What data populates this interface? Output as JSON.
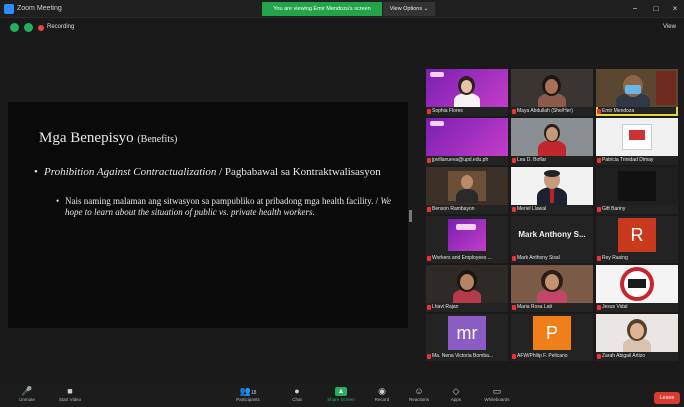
{
  "window": {
    "title": "Zoom Meeting",
    "viewing_banner": "You are viewing Emir Mendoza's screen",
    "view_options": "View Options ⌄",
    "minimize": "−",
    "maximize": "□",
    "close": "×"
  },
  "subbar": {
    "recording_label": "Recording",
    "view_label": "View"
  },
  "slide": {
    "title_main": "Mga Benepisyo",
    "title_sub": "(Benefits)",
    "bullet1_dot": "•",
    "bullet1_italic": "Prohibition Against Contractualization",
    "bullet1_rest": " / Pagbabawal sa Kontraktwalisasyon",
    "bullet2_dot": "•",
    "bullet2_plain": "Nais naming malaman ang sitwasyon sa pampubliko at pribadong mga health facility. / ",
    "bullet2_italic": "We hope to learn about the situation of public vs. private health workers."
  },
  "participants": [
    {
      "name": "Sophia Flores",
      "kind": "video"
    },
    {
      "name": "Maya Abdullah (She/Her)",
      "kind": "video"
    },
    {
      "name": "Emir Mendoza",
      "kind": "video"
    },
    {
      "name": "jpvillanueva@upd.edu.ph",
      "kind": "video"
    },
    {
      "name": "Lea D. Boflar",
      "kind": "video"
    },
    {
      "name": "Patricia Trinidad Dimay",
      "kind": "video"
    },
    {
      "name": "Benson Rambayon",
      "kind": "video"
    },
    {
      "name": "Meriel Llawal",
      "kind": "video"
    },
    {
      "name": "Gift Bariny",
      "kind": "blank"
    },
    {
      "name": "Workers and Employees ...",
      "kind": "video"
    },
    {
      "name": "Mark Anthony Sisal",
      "kind": "text",
      "display": "Mark Anthony S..."
    },
    {
      "name": "Rey Rasing",
      "kind": "initial",
      "display": "R"
    },
    {
      "name": "Lhavi Rajan",
      "kind": "video"
    },
    {
      "name": "Maria Rosa Lati",
      "kind": "video"
    },
    {
      "name": "Jesus Vidal",
      "kind": "video"
    },
    {
      "name": "Ma. Nena Victoria Bomba...",
      "kind": "initial",
      "display": "mr"
    },
    {
      "name": "AFW/Philip F. Pelicano",
      "kind": "initial",
      "display": "P"
    },
    {
      "name": "Zarah Abigail Artizo",
      "kind": "video"
    }
  ],
  "toolbar": {
    "unmute": "Unmute",
    "start_video": "Start Video",
    "participants": "Participants",
    "participants_count": "18",
    "chat": "Chat",
    "share_screen": "Share Screen",
    "record": "Record",
    "reactions": "Reactions",
    "apps": "Apps",
    "whiteboards": "Whiteboards",
    "leave": "Leave"
  },
  "colors": {
    "share_green": "#27ae60",
    "leave_red": "#d93a32",
    "active_speaker": "#e6d43a",
    "purple_bg": "#7a1fb2"
  }
}
